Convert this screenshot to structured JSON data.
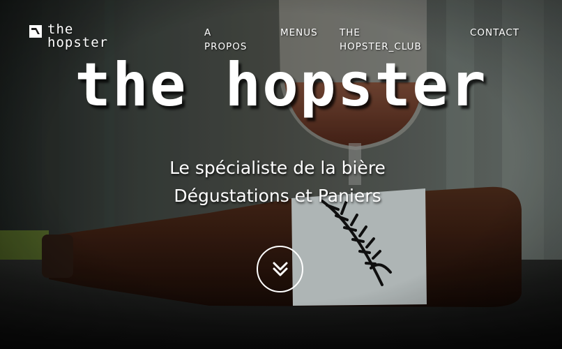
{
  "logo": {
    "line1": "the",
    "line2": "hopster"
  },
  "nav": {
    "items": [
      {
        "label": "A PROPOS"
      },
      {
        "label": "MENUS"
      },
      {
        "label": "THE HOPSTER_CLUB"
      },
      {
        "label": "CONTACT"
      }
    ]
  },
  "hero": {
    "title": "the hopster",
    "tagline1": "Le spécialiste de la bière",
    "tagline2": "Dégustations et Paniers"
  },
  "icons": {
    "logo": "logo-mark-icon",
    "scroll": "double-chevron-down-icon"
  }
}
